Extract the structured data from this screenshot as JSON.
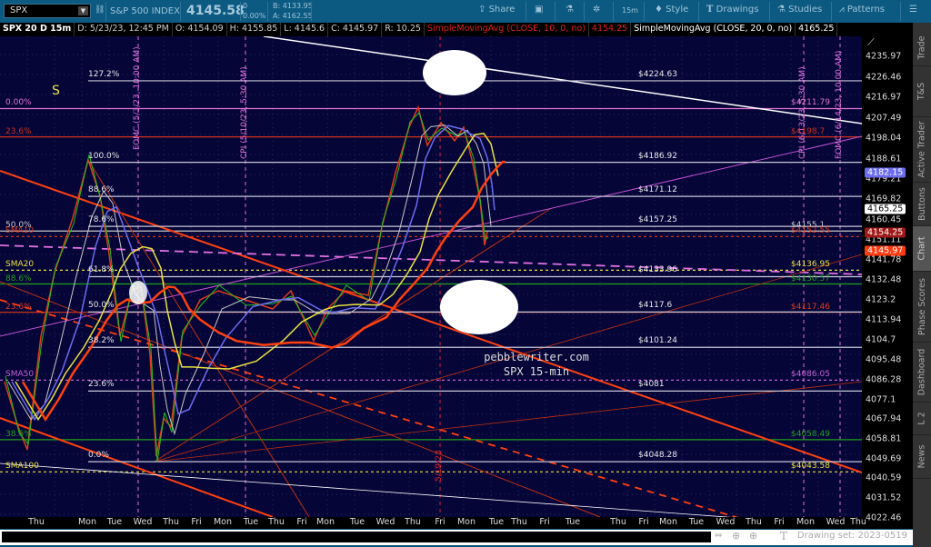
{
  "toolbar": {
    "symbol": "SPX",
    "name": "S&P 500 INDEX",
    "last": "4145.58",
    "change": "0",
    "change_pct": "0.00%",
    "bid": "B: 4133.95",
    "ask": "A: 4162.55",
    "buttons": {
      "share": "Share",
      "interval": "15m",
      "style": "Style",
      "drawings": "Drawings",
      "studies": "Studies",
      "patterns": "Patterns"
    }
  },
  "info": {
    "title": "SPX 20 D 15m",
    "date": "D: 5/23/23, 12:45 PM",
    "open": "O: 4154.09",
    "high": "H: 4155.85",
    "low": "L: 4145.6",
    "close": "C: 4145.97",
    "range": "R: 10.25",
    "sma10_label": "SimpleMovingAvg (CLOSE, 10, 0, no)",
    "sma10_value": "4154.25",
    "sma20_label": "SimpleMovingAvg (CLOSE, 20, 0, no)",
    "sma20_value": "4165.25"
  },
  "y_axis": {
    "ticks": [
      "4235.97",
      "4226.46",
      "4216.97",
      "4207.49",
      "4198.04",
      "4188.61",
      "4179.21",
      "4169.82",
      "4160.45",
      "4151.11",
      "4141.78",
      "4132.48",
      "4123.2",
      "4113.94",
      "4104.7",
      "4095.48",
      "4086.28",
      "4077.1",
      "4067.94",
      "4058.81",
      "4049.69",
      "4040.59",
      "4031.52",
      "4022.46"
    ],
    "badges": [
      {
        "value": "4182.15",
        "color": "#6b6bf0"
      },
      {
        "value": "4165.25",
        "color": "#ffffff"
      },
      {
        "value": "4154.25",
        "color": "#a01818"
      },
      {
        "value": "4145.97",
        "color": "#ff3a10"
      }
    ]
  },
  "x_axis": {
    "labels": [
      "Thu",
      "Mon",
      "Tue",
      "Wed",
      "Thu",
      "Fri",
      "Mon",
      "Tue",
      "Thu",
      "Fri",
      "Mon",
      "Tue",
      "Wed",
      "Thu",
      "Fri",
      "Mon",
      "Tue",
      "Thu",
      "Fri",
      "Tue",
      "Thu",
      "Fri",
      "Mon",
      "Tue",
      "Wed",
      "Thu",
      "Fri",
      "Mon",
      "Wed",
      "Thu"
    ]
  },
  "fib": [
    {
      "pct": "127.2%",
      "price": 4224.63,
      "label": "$4224.63"
    },
    {
      "pct": "100.0%",
      "price": 4186.92,
      "label": "$4186.92"
    },
    {
      "pct": "88.6%",
      "price": 4171.12,
      "label": "$4171.12"
    },
    {
      "pct": "78.6%",
      "price": 4157.25,
      "label": "$4157.25"
    },
    {
      "pct": "61.8%",
      "price": 4133.96,
      "label": "$4133.96"
    },
    {
      "pct": "50.0%",
      "price": 4117.6,
      "label": "$4117.6"
    },
    {
      "pct": "38.2%",
      "price": 4101.24,
      "label": "$4101.24"
    },
    {
      "pct": "23.6%",
      "price": 4081,
      "label": "$4081"
    },
    {
      "pct": "0.0%",
      "price": 4048.28,
      "label": "$4048.28"
    }
  ],
  "levels": [
    {
      "left": "0.00%",
      "right": "$4211.79",
      "price": 4211.79,
      "color": "#e070d0"
    },
    {
      "left": "23.6%",
      "right": "$4198.7",
      "price": 4198.7,
      "color": "#d0301a"
    },
    {
      "left": "50.0%",
      "right": "$4155.1",
      "price": 4155.1,
      "color": "#c8c8c8"
    },
    {
      "left": "SMA10",
      "right": "$4152.55",
      "price": 4152.55,
      "color": "#e03a1a"
    },
    {
      "left": "SMA20",
      "right": "$4136.95",
      "price": 4136.95,
      "color": "#e8e040"
    },
    {
      "left": "88.6%",
      "right": "$4130.57",
      "price": 4130.57,
      "color": "#1ea01e"
    },
    {
      "left": "23.6%",
      "right": "$4117.46",
      "price": 4117.46,
      "color": "#e03a1a"
    },
    {
      "left": "SMA50",
      "right": "$4086.05",
      "price": 4086.05,
      "color": "#c060d0"
    },
    {
      "left": "38.6%",
      "right": "$4058.49",
      "price": 4058.49,
      "color": "#1ea01e"
    },
    {
      "left": "SMA100",
      "right": "$4043.58",
      "price": 4043.58,
      "color": "#e8e040"
    }
  ],
  "events": [
    {
      "label": "FOMC (5/3/23, 10:00 AM)",
      "color": "#e070e0"
    },
    {
      "label": "CPI (5/10/23, 5:30 AM)",
      "color": "#e070e0"
    },
    {
      "label": "5/19/23",
      "color": "#e02030"
    },
    {
      "label": "CPI (6/13/23, 5:30 AM)",
      "color": "#e070e0"
    },
    {
      "label": "FOMC (6/14/23, 10:00 AM)",
      "color": "#e070e0"
    }
  ],
  "marker_s": "S",
  "watermark": {
    "line1": "pebblewriter.com",
    "line2": "SPX 15-min"
  },
  "drawing_set": "Drawing set: 2023-0519",
  "side_tabs": [
    "Trade",
    "T&S",
    "Active Trader",
    "Buttons",
    "Chart",
    "Phase Scores",
    "Dashboard",
    "L 2",
    "News"
  ],
  "selected_tab": "Chart"
}
